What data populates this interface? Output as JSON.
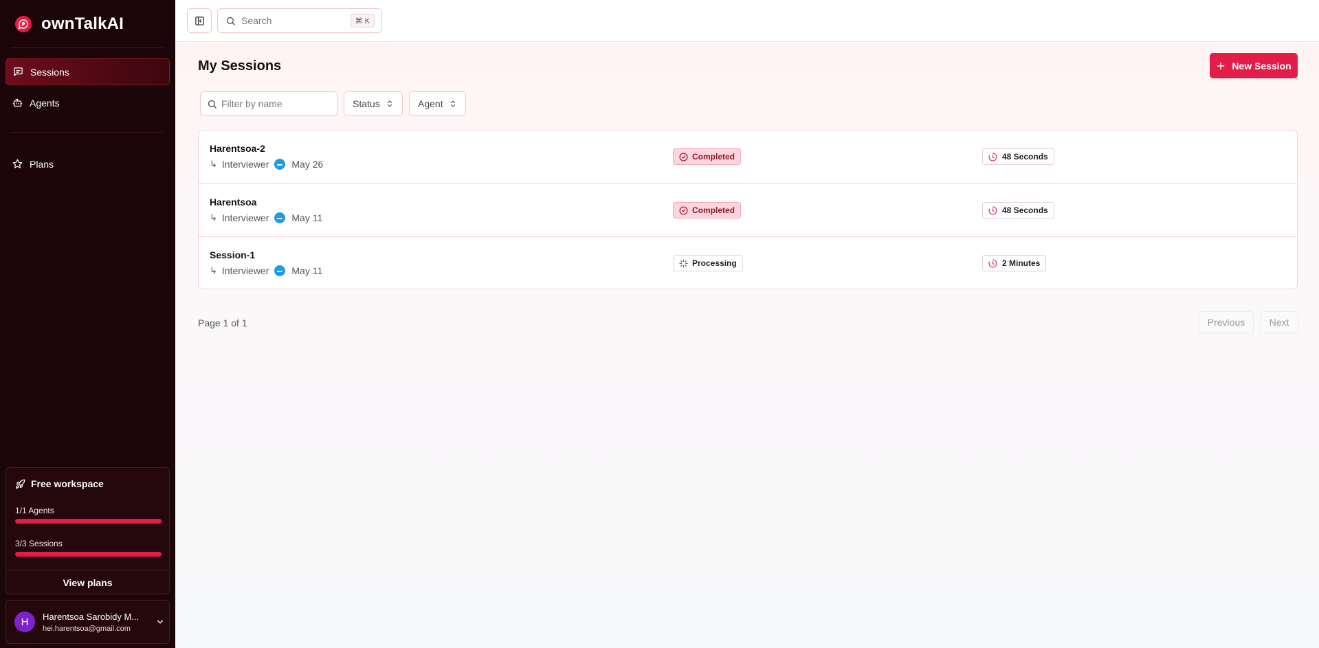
{
  "app": {
    "name": "ownTalkAI"
  },
  "sidebar": {
    "items": [
      {
        "label": "Sessions",
        "icon": "message-square-icon",
        "active": true
      },
      {
        "label": "Agents",
        "icon": "bot-icon"
      },
      {
        "label": "Plans",
        "icon": "star-icon"
      }
    ],
    "workspace": {
      "title": "Free workspace",
      "agents_label": "1/1 Agents",
      "agents_progress": 1.0,
      "sessions_label": "3/3 Sessions",
      "sessions_progress": 1.0,
      "view_plans": "View plans"
    },
    "user": {
      "initial": "H",
      "name": "Harentsoa Sarobidy M...",
      "email": "hei.harentsoa@gmail.com"
    }
  },
  "topbar": {
    "search_placeholder": "Search",
    "shortcut": "⌘ K"
  },
  "main": {
    "title": "My Sessions",
    "new_session": "New Session",
    "filter_placeholder": "Filter by name",
    "status_filter": "Status",
    "agent_filter": "Agent",
    "sessions": [
      {
        "name": "Harentsoa-2",
        "agent": "Interviewer",
        "date": "May 26",
        "status": "Completed",
        "duration": "48 Seconds"
      },
      {
        "name": "Harentsoa",
        "agent": "Interviewer",
        "date": "May 11",
        "status": "Completed",
        "duration": "48 Seconds"
      },
      {
        "name": "Session-1",
        "agent": "Interviewer",
        "date": "May 11",
        "status": "Processing",
        "duration": "2 Minutes"
      }
    ],
    "pagination": {
      "label": "Page 1 of 1",
      "previous": "Previous",
      "next": "Next"
    }
  },
  "colors": {
    "accent": "#e11d48",
    "sidebar_bg": "#1c0508",
    "completed_bg": "#fdd5de",
    "avatar": "#7e22ce",
    "agent_icon": "#1e9be6"
  }
}
